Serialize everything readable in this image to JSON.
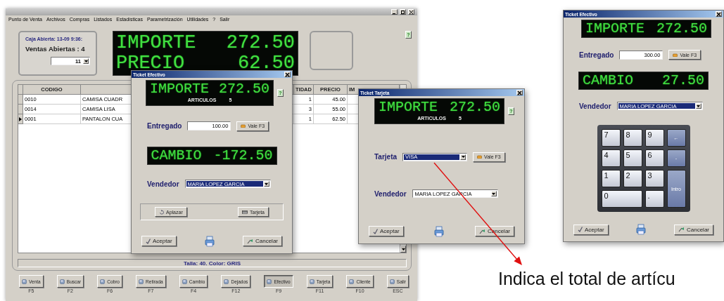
{
  "main_window": {
    "menu": [
      "Punto de Venta",
      "Archivos",
      "Compras",
      "Listados",
      "Estadísticas",
      "Parametrización",
      "Utilidades",
      "?",
      "Salir"
    ],
    "session": {
      "status": "Caja Abierta: 13-09  9:36:",
      "open_sales": "Ventas Abiertas : 4",
      "selector": "11"
    },
    "display": [
      {
        "label": "IMPORTE",
        "value": "272.50"
      },
      {
        "label": "PRECIO",
        "value": "62.50"
      }
    ],
    "help": "?",
    "table": {
      "columns": [
        "CODIGO",
        "TIDAD",
        "PRECIO",
        "IM"
      ],
      "rows": [
        {
          "code": "0010",
          "description": "CAMISA CUADR",
          "quantity": "1",
          "price": "45.00",
          "selected": false
        },
        {
          "code": "0014",
          "description": "CAMISA LISA",
          "quantity": "3",
          "price": "55.00",
          "selected": false
        },
        {
          "code": "0001",
          "description": "PANTALON CUA",
          "quantity": "1",
          "price": "62.50",
          "selected": true
        }
      ]
    },
    "status_bar": "Talla: 40. Color: GRIS",
    "buttons": [
      {
        "label": "Venta",
        "key": "F5",
        "selected": false
      },
      {
        "label": "Buscar",
        "key": "F2",
        "selected": false
      },
      {
        "label": "Cobro",
        "key": "F6",
        "selected": false
      },
      {
        "label": "Retirada",
        "key": "F7",
        "selected": false
      },
      {
        "label": "Cambio",
        "key": "F4",
        "selected": false
      },
      {
        "label": "Dejados",
        "key": "F12",
        "selected": false
      },
      {
        "label": "Efectivo",
        "key": "F9",
        "selected": true
      },
      {
        "label": "Tarjeta",
        "key": "F11",
        "selected": false
      },
      {
        "label": "Cliente",
        "key": "F10",
        "selected": false
      },
      {
        "label": "Salir",
        "key": "ESC",
        "selected": false
      }
    ]
  },
  "dialogs": [
    {
      "title": "Ticket Efectivo",
      "sections": [
        {
          "kind": "total",
          "label": "IMPORTE",
          "value": "272.50",
          "sub_label": "ARTICULOS",
          "sub_value": "5",
          "help": "?"
        },
        {
          "kind": "input",
          "label": "Entregado",
          "value": "100.00",
          "button": "Vale F3"
        },
        {
          "kind": "display",
          "label": "CAMBIO",
          "value": "-172.50"
        },
        {
          "kind": "select",
          "label": "Vendedor",
          "value": "MARIA LOPEZ GARCIA",
          "highlighted": true
        },
        {
          "kind": "actions",
          "items": [
            "Aplazar",
            "Tarjeta"
          ]
        },
        {
          "kind": "footer",
          "accept": "Aceptar",
          "cancel": "Cancelar"
        }
      ]
    },
    {
      "title": "Ticket Tarjeta",
      "sections": [
        {
          "kind": "total",
          "label": "IMPORTE",
          "value": "272.50",
          "sub_label": "ARTICULOS",
          "sub_value": "5",
          "help": "?"
        },
        {
          "kind": "select",
          "label": "Tarjeta",
          "value": "VISA",
          "highlighted": true,
          "button": "Vale F3"
        },
        {
          "kind": "select",
          "label": "Vendedor",
          "value": "MARIA LOPEZ GARCIA",
          "highlighted": false
        },
        {
          "kind": "footer",
          "accept": "Aceptar",
          "cancel": "Cancelar"
        }
      ]
    },
    {
      "title": "Ticket Efectivo",
      "sections": [
        {
          "kind": "total",
          "label": "IMPORTE",
          "value": "272.50"
        },
        {
          "kind": "input",
          "label": "Entregado",
          "value": "300.00",
          "button": "Vale F3"
        },
        {
          "kind": "display",
          "label": "CAMBIO",
          "value": "27.50"
        },
        {
          "kind": "select",
          "label": "Vendedor",
          "value": "MARIA LOPEZ GARCIA",
          "highlighted": true
        },
        {
          "kind": "keypad",
          "keys": [
            {
              "label": "7",
              "kind": "digit"
            },
            {
              "label": "8",
              "kind": "digit"
            },
            {
              "label": "9",
              "kind": "digit"
            },
            {
              "label": "←",
              "kind": "function"
            },
            {
              "label": "4",
              "kind": "digit"
            },
            {
              "label": "5",
              "kind": "digit"
            },
            {
              "label": "6",
              "kind": "digit"
            },
            {
              "label": "-",
              "kind": "function"
            },
            {
              "label": "1",
              "kind": "digit"
            },
            {
              "label": "2",
              "kind": "digit"
            },
            {
              "label": "3",
              "kind": "digit"
            },
            {
              "label": "Intro",
              "kind": "tall"
            },
            {
              "label": "0",
              "kind": "wide"
            },
            {
              "label": ".",
              "kind": "digit"
            }
          ]
        },
        {
          "kind": "footer",
          "accept": "Aceptar",
          "cancel": "Cancelar"
        }
      ]
    }
  ],
  "caption": "Indica el total de artícu"
}
